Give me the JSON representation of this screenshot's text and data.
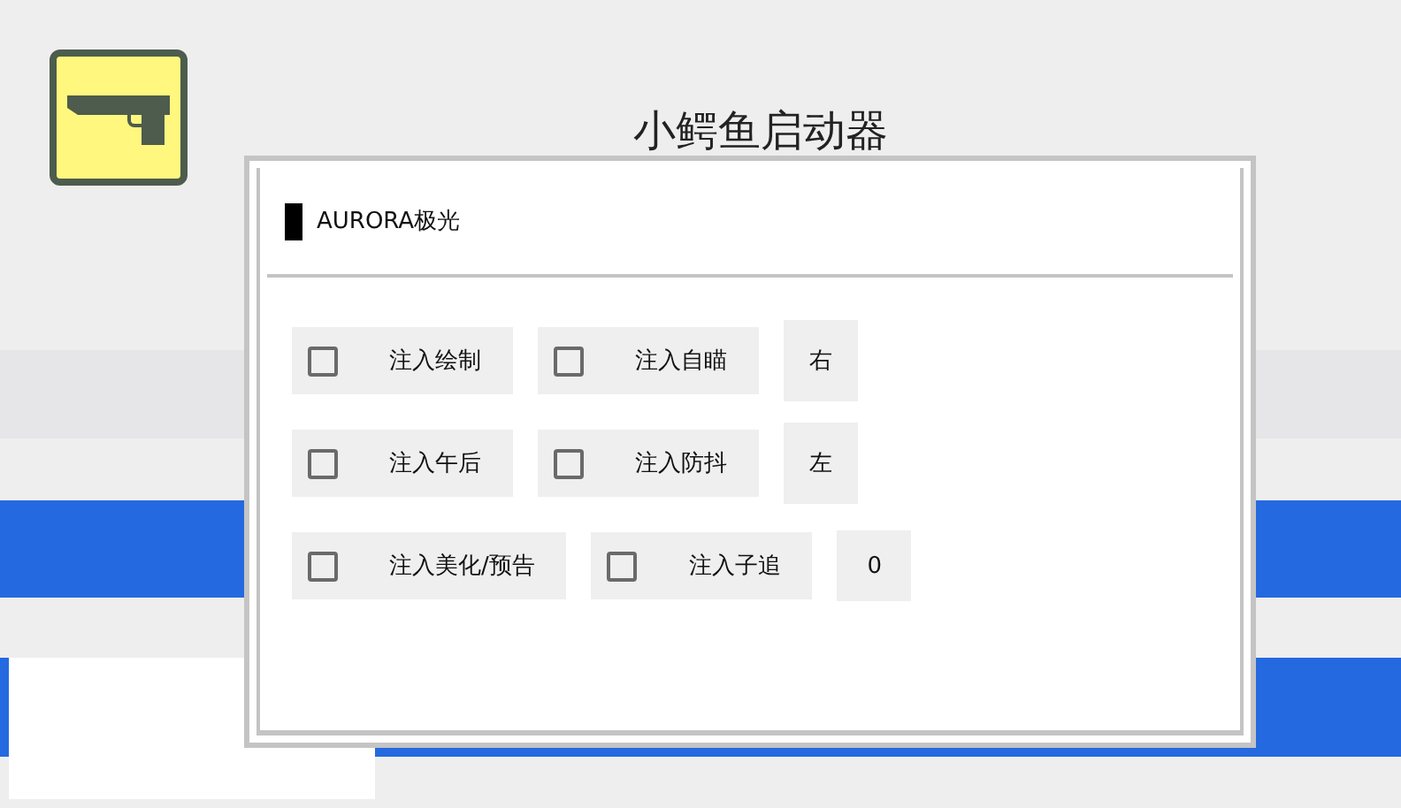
{
  "app": {
    "title": "小鳄鱼启动器"
  },
  "dialog": {
    "header": "AURORA极光",
    "rows": [
      {
        "options": [
          {
            "label": "注入绘制",
            "checked": false
          },
          {
            "label": "注入自瞄",
            "checked": false
          }
        ],
        "value": "右"
      },
      {
        "options": [
          {
            "label": "注入午后",
            "checked": false
          },
          {
            "label": "注入防抖",
            "checked": false
          }
        ],
        "value": "左"
      },
      {
        "options": [
          {
            "label": "注入美化/预告",
            "checked": false
          },
          {
            "label": "注入子追",
            "checked": false
          }
        ],
        "value": "0"
      }
    ]
  }
}
